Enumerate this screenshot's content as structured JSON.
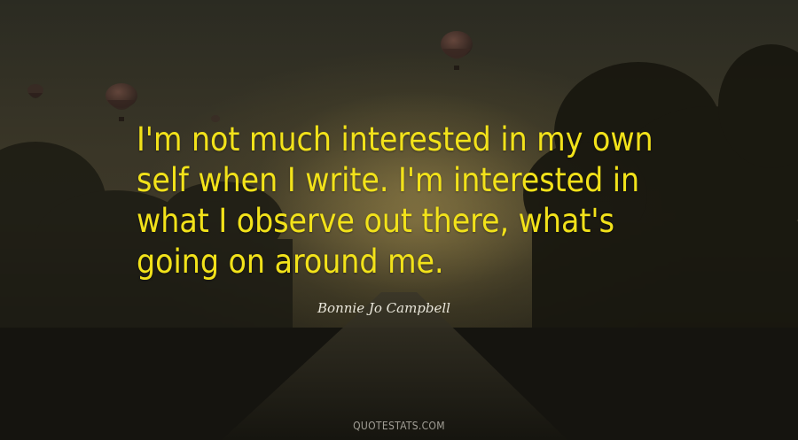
{
  "quote": {
    "lines": [
      "I'm not much interested in my own",
      "self when I write. I'm interested in",
      "what I observe out there, what's",
      "going on around me."
    ]
  },
  "author": "Bonnie Jo Campbell",
  "watermark": "QUOTESTATS.COM",
  "colors": {
    "quote_text": "#f2e21a",
    "author_text": "#e9e6da",
    "watermark_text": "#b9b6ad"
  }
}
